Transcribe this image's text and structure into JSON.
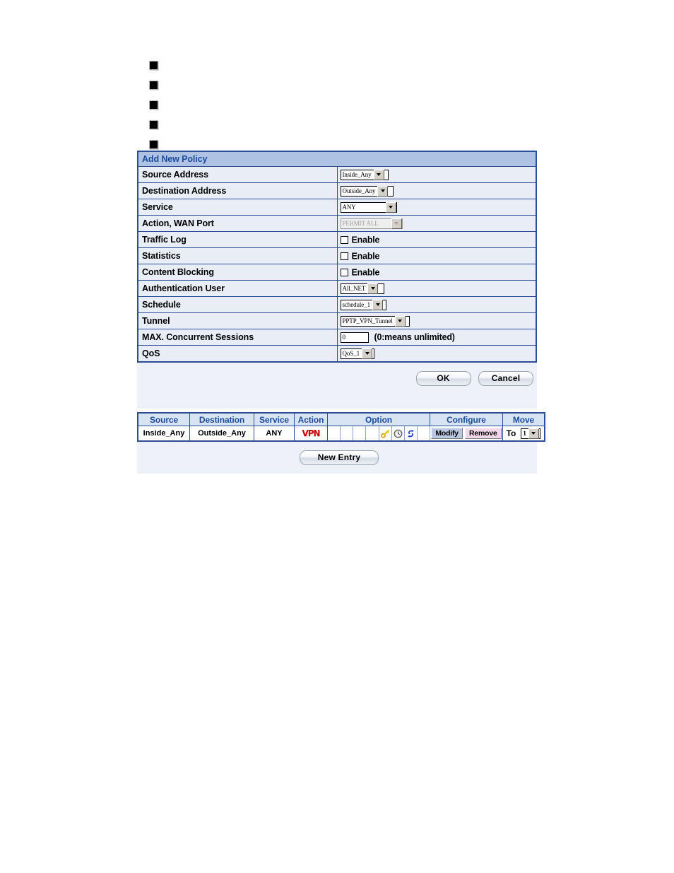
{
  "bullets": [
    {
      "marker": "square"
    },
    {
      "marker": "square"
    },
    {
      "marker": "square"
    },
    {
      "marker": "square"
    },
    {
      "marker": "square"
    }
  ],
  "colors": {
    "title_bar_bg": "#aec3e4",
    "title_text": "#1b4b9c",
    "table_border": "#2b4f96",
    "row_bg": "#e8edf6",
    "page_bg": "#eef2f8",
    "header_bg": "#d8e3f3",
    "vpn_red": "#cc0000",
    "modify_bg": "#b9c8e0",
    "remove_bg": "#f0d6e6"
  },
  "policy_form": {
    "title": "Add New Policy",
    "rows": [
      {
        "label": "Source Address",
        "control": "select",
        "value": "Inside_Any",
        "disabled": false
      },
      {
        "label": "Destination Address",
        "control": "select",
        "value": "Outside_Any",
        "disabled": false
      },
      {
        "label": "Service",
        "control": "select",
        "value": "ANY",
        "disabled": false
      },
      {
        "label": "Action, WAN Port",
        "control": "select",
        "value": "PERMIT ALL",
        "disabled": true
      },
      {
        "label": "Traffic Log",
        "control": "checkbox",
        "value": "Enable",
        "checked": false
      },
      {
        "label": "Statistics",
        "control": "checkbox",
        "value": "Enable",
        "checked": false
      },
      {
        "label": "Content Blocking",
        "control": "checkbox",
        "value": "Enable",
        "checked": false
      },
      {
        "label": "Authentication User",
        "control": "select",
        "value": "All_NET",
        "disabled": false
      },
      {
        "label": "Schedule",
        "control": "select",
        "value": "schedule_1",
        "disabled": false
      },
      {
        "label": "Tunnel",
        "control": "select",
        "value": "PPTP_VPN_Tunnel",
        "disabled": false
      },
      {
        "label": "MAX. Concurrent Sessions",
        "control": "text",
        "value": "0",
        "hint": "(0:means unlimited)"
      },
      {
        "label": "QoS",
        "control": "select",
        "value": "QoS_1",
        "disabled": false
      }
    ],
    "buttons": {
      "ok": "OK",
      "cancel": "Cancel"
    }
  },
  "policy_list": {
    "headers": {
      "source": "Source",
      "destination": "Destination",
      "service": "Service",
      "action": "Action",
      "option": "Option",
      "configure": "Configure",
      "move": "Move"
    },
    "row": {
      "source": "Inside_Any",
      "destination": "Outside_Any",
      "service": "ANY",
      "action_icon": "VPN",
      "option_icons": [
        "",
        "",
        "",
        "",
        "key-icon",
        "clock-icon",
        "qos-icon",
        ""
      ],
      "modify": "Modify",
      "remove": "Remove",
      "move_label": "To",
      "move_value": "1"
    },
    "new_entry": "New Entry"
  }
}
